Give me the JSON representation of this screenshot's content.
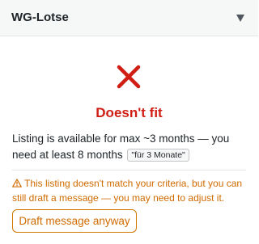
{
  "header": {
    "title": "WG-Lotse",
    "toggle_icon": "caret-down-icon"
  },
  "result": {
    "icon": "red-x-icon",
    "title": "Doesn't fit",
    "reason_text": "Listing is available for max ~3 months — you need at least 8 months",
    "quote": "\"für 3 Monate\""
  },
  "warning": {
    "icon": "warning-triangle-icon",
    "text": "This listing doesn't match your criteria, but you can still draft a message — you may need to adjust it."
  },
  "actions": {
    "draft_label": "Draft message anyway"
  },
  "colors": {
    "error_red": "#d01e14",
    "warning_orange": "#d06b00",
    "header_bg": "#f6f7f7",
    "text_dark": "#1d2327"
  }
}
